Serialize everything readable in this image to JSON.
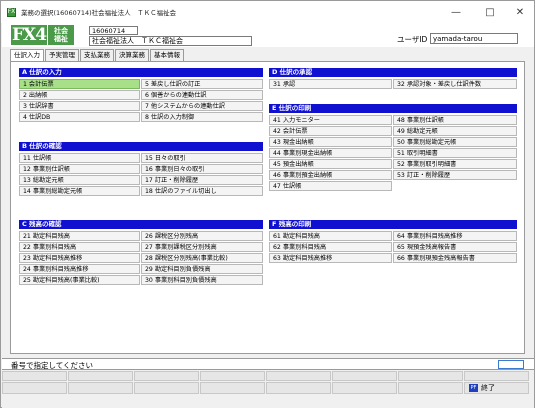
{
  "window": {
    "title": "業務の選択(16060714)社会福祉法人　ＴＫＣ福祉会",
    "icon_text": "FX"
  },
  "header": {
    "logo": "FX4",
    "logo_sub1": "社会",
    "logo_sub2": "福祉",
    "code": "16060714",
    "corporation": "社会福祉法人　ＴＫＣ福祉会",
    "user_label": "ユーザID",
    "user_id": "yamada-tarou"
  },
  "tabs": [
    "仕訳入力",
    "予実管理",
    "支払業務",
    "決算業務",
    "基本情報"
  ],
  "sections": {
    "A": {
      "title": "A 仕訳の入力",
      "items": [
        "1 会計伝票",
        "5 差戻し仕訳の訂正",
        "2 出納帳",
        "6 個善からの連動仕訳",
        "3 仕訳辞書",
        "7 他システムからの連動仕訳",
        "4 仕訳DB",
        "8 仕訳の入力制御"
      ]
    },
    "D": {
      "title": "D 仕訳の承認",
      "items": [
        "31 承認",
        "32 承認対象・差戻し仕訳件数"
      ]
    },
    "E": {
      "title": "E 仕訳の印刷",
      "items": [
        "41 入力モニター",
        "48 事業別仕訳帳",
        "42 会計伝票",
        "49 総勘定元帳",
        "43 現金出納帳",
        "50 事業別総勘定元帳",
        "44 事業別現金出納帳",
        "51 取引明細書",
        "45 預金出納帳",
        "52 事業別取引明細書",
        "46 事業別預金出納帳",
        "53 訂正・削除履歴",
        "47 仕訳帳",
        ""
      ]
    },
    "B": {
      "title": "B 仕訳の確認",
      "items": [
        "11 仕訳帳",
        "15 日々の取引",
        "12 事業別仕訳帳",
        "16 事業別日々の取引",
        "13 総勘定元帳",
        "17 訂正・削除履歴",
        "14 事業別総勘定元帳",
        "18 仕訳のファイル切出し"
      ]
    },
    "C": {
      "title": "C 残高の確認",
      "items": [
        "21 勘定科目残高",
        "26 課税区分別残高",
        "22 事業別科目残高",
        "27 事業別課税区分別残高",
        "23 勘定科目残高推移",
        "28 課税区分別残高(事業比較)",
        "24 事業別科目残高推移",
        "29 勘定科目別負債残高",
        "25 勘定科目残高(事業比較)",
        "30 事業別科目別負債残高"
      ]
    },
    "F": {
      "title": "F 残高の印刷",
      "items": [
        "61 勘定科目残高",
        "64 事業別科目残高推移",
        "62 事業別科目残高",
        "65 現預金残高報告書",
        "63 勘定科目残高推移",
        "66 事業別現預金残高報告書"
      ]
    }
  },
  "command": {
    "label": "番号で指定してください"
  },
  "footer": {
    "exit_icon": "PF",
    "exit_label": "終了"
  }
}
